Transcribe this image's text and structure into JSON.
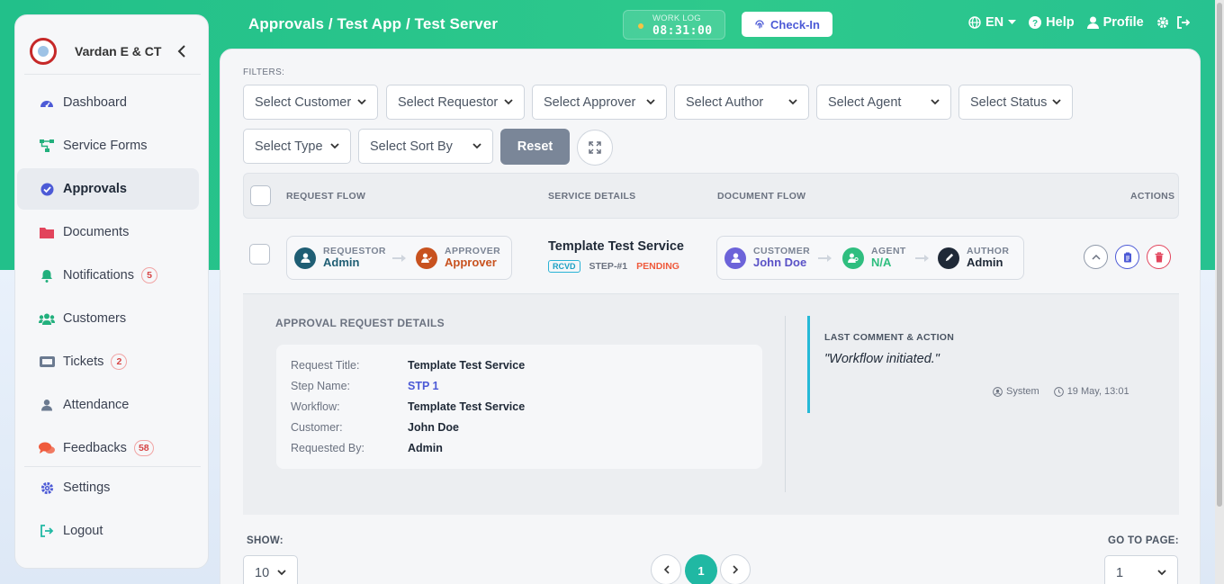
{
  "header": {
    "breadcrumb": "Approvals / Test App / Test Server",
    "worklog_label": "WORK LOG",
    "worklog_time": "08:31:00",
    "checkin_label": "Check-In",
    "language": "EN",
    "help_label": "Help",
    "profile_label": "Profile"
  },
  "sidebar": {
    "brand": "Vardan E & CT",
    "items": [
      {
        "label": "Dashboard",
        "icon": "gauge-icon",
        "color": "#4c5ad6"
      },
      {
        "label": "Service Forms",
        "icon": "sitemap-icon",
        "color": "#22b07d"
      },
      {
        "label": "Approvals",
        "icon": "check-circle-icon",
        "color": "#4c5ad6",
        "active": true
      },
      {
        "label": "Documents",
        "icon": "folder-icon",
        "color": "#e2445c"
      },
      {
        "label": "Notifications",
        "icon": "bell-icon",
        "color": "#22b07d",
        "badge": "5"
      },
      {
        "label": "Customers",
        "icon": "users-icon",
        "color": "#22b07d"
      },
      {
        "label": "Tickets",
        "icon": "ticket-icon",
        "color": "#6b7a90",
        "badge": "2"
      },
      {
        "label": "Attendance",
        "icon": "user-icon",
        "color": "#6b7a90"
      },
      {
        "label": "Feedbacks",
        "icon": "comments-icon",
        "color": "#ef5a3c",
        "badge": "58"
      },
      {
        "label": "Settings",
        "icon": "gear-icon",
        "color": "#4c5ad6"
      },
      {
        "label": "Logout",
        "icon": "logout-icon",
        "color": "#20b8a3"
      }
    ]
  },
  "filters": {
    "label": "FILTERS:",
    "selects": [
      "Select Customer",
      "Select Requestor",
      "Select Approver",
      "Select Author",
      "Select Agent",
      "Select Status",
      "Select Type",
      "Select Sort By"
    ],
    "reset_label": "Reset"
  },
  "table": {
    "headers": {
      "request_flow": "REQUEST FLOW",
      "service_details": "SERVICE DETAILS",
      "document_flow": "DOCUMENT FLOW",
      "actions": "ACTIONS"
    },
    "row": {
      "requestor_key": "REQUESTOR",
      "requestor_value": "Admin",
      "approver_key": "APPROVER",
      "approver_value": "Approver",
      "service_title": "Template Test Service",
      "tag": "RCVD",
      "step": "STEP-#1",
      "status": "PENDING",
      "customer_key": "CUSTOMER",
      "customer_value": "John Doe",
      "agent_key": "AGENT",
      "agent_value": "N/A",
      "author_key": "AUTHOR",
      "author_value": "Admin"
    }
  },
  "details": {
    "heading": "APPROVAL REQUEST DETAILS",
    "fields": [
      {
        "k": "Request Title:",
        "v": "Template Test Service"
      },
      {
        "k": "Step Name:",
        "v": "STP 1"
      },
      {
        "k": "Workflow:",
        "v": "Template Test Service"
      },
      {
        "k": "Customer:",
        "v": "John Doe"
      },
      {
        "k": "Requested By:",
        "v": "Admin"
      }
    ],
    "comment_heading": "LAST COMMENT & ACTION",
    "comment_text": "\"Workflow initiated.\"",
    "comment_by": "System",
    "comment_time": "19 May, 13:01"
  },
  "pagination": {
    "show_label": "SHOW:",
    "show_value": "10",
    "current_page": "1",
    "goto_label": "GO TO PAGE:",
    "goto_value": "1"
  },
  "colors": {
    "brand_green": "#22c08a",
    "accent_blue": "#4c5ad6",
    "pending": "#ef5a3c",
    "teal": "#20b8a3"
  }
}
